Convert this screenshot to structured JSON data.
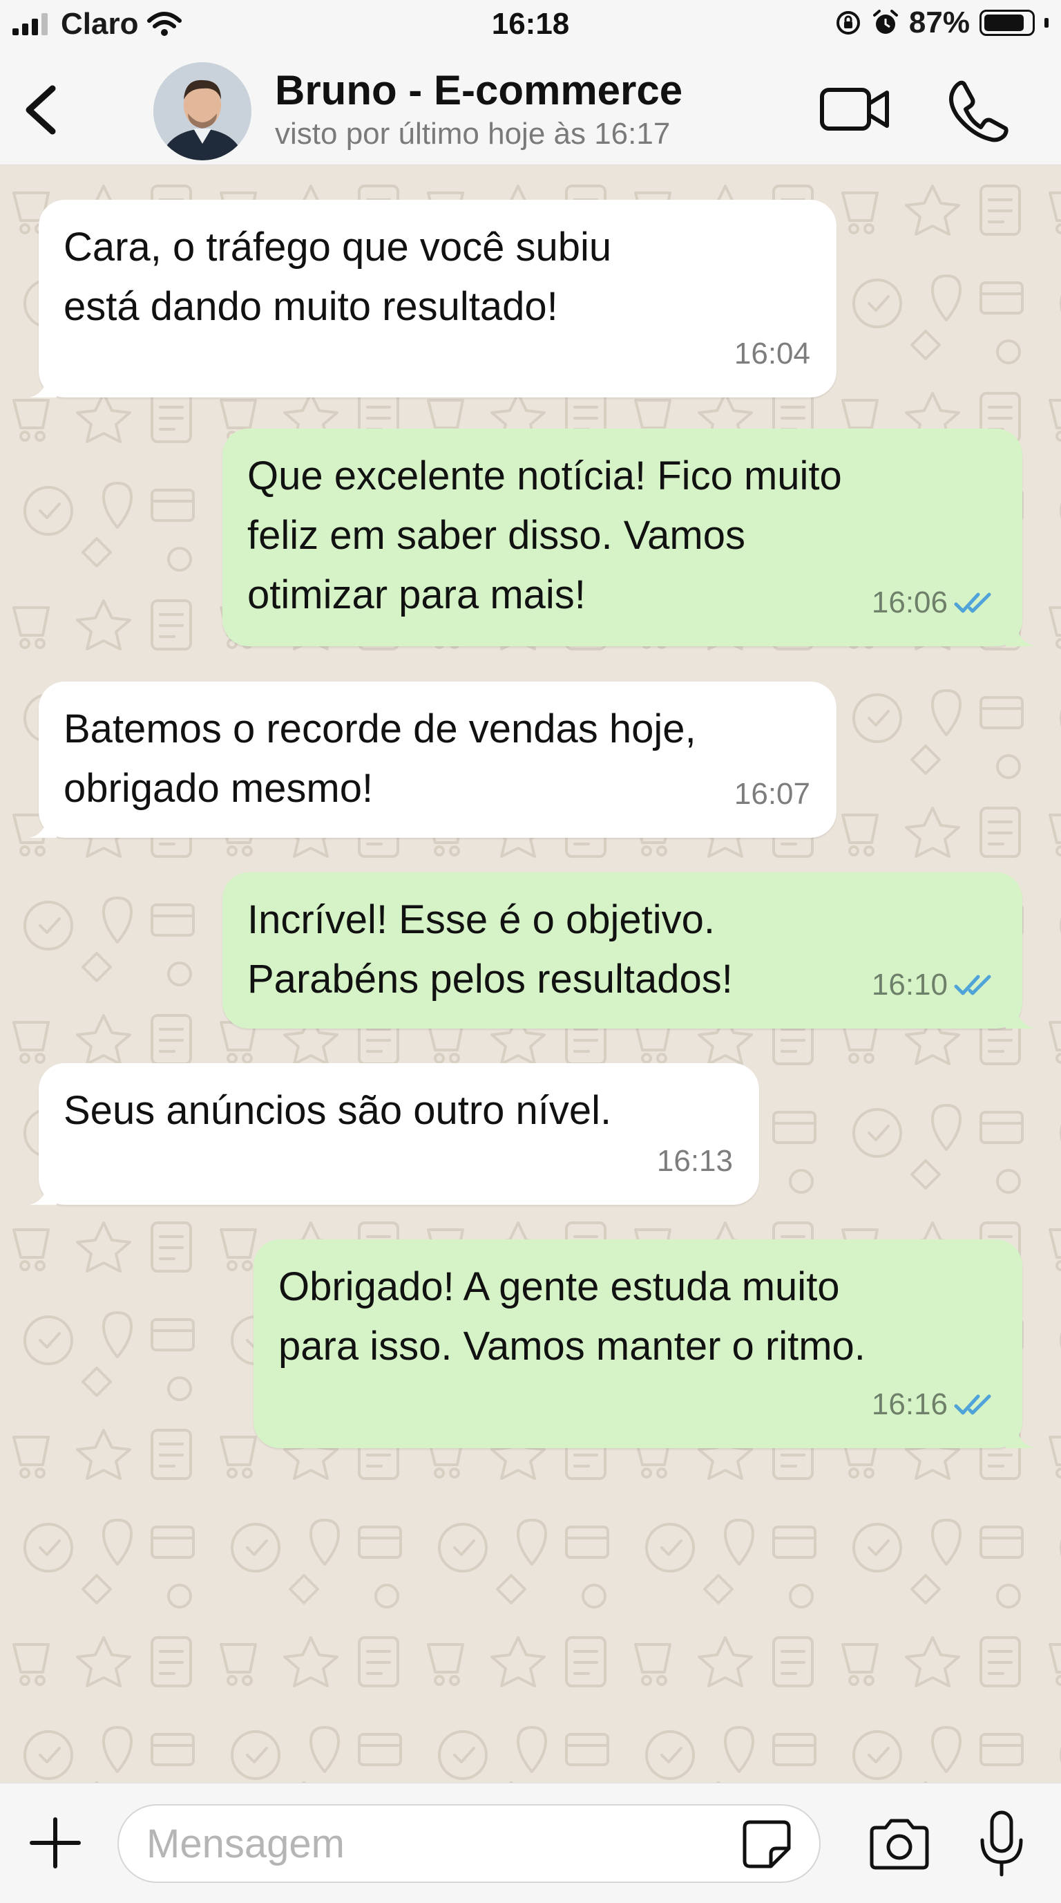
{
  "status_bar": {
    "carrier": "Claro",
    "time": "16:18",
    "battery": "87%",
    "battery_level": 0.87
  },
  "header": {
    "contact_name": "Bruno - E-commerce",
    "last_seen": "visto por último hoje às 16:17",
    "icons": [
      "back-arrow-icon",
      "video-camera-icon",
      "phone-icon"
    ]
  },
  "messages": [
    {
      "direction": "incoming",
      "text": "Cara, o tráfego que você subiu\nestá dando muito resultado!",
      "time": "16:04"
    },
    {
      "direction": "outgoing",
      "text": "Que excelente notícia! Fico muito\nfeliz em saber disso. Vamos\notimizar para mais!",
      "time": "16:06",
      "read": true
    },
    {
      "direction": "incoming",
      "text": "Batemos o recorde de vendas hoje,\nobrigado mesmo!",
      "time": "16:07"
    },
    {
      "direction": "outgoing",
      "text": "Incrível! Esse é o objetivo.\nParabéns pelos resultados!",
      "time": "16:10",
      "read": true
    },
    {
      "direction": "incoming",
      "text": "Seus anúncios são outro nível.",
      "time": "16:13"
    },
    {
      "direction": "outgoing",
      "text": "Obrigado! A gente estuda muito\npara isso. Vamos manter o ritmo.",
      "time": "16:16",
      "read": true
    }
  ],
  "composer": {
    "placeholder": "Mensagem",
    "icons": [
      "plus-icon",
      "sticker-icon",
      "camera-icon",
      "microphone-icon"
    ]
  },
  "colors": {
    "chat_background": "#ebe4da",
    "incoming_bubble": "#ffffff",
    "outgoing_bubble": "#d5f3c6",
    "read_ticks": "#4fa3d9",
    "bar_background": "#f6f6f6"
  }
}
